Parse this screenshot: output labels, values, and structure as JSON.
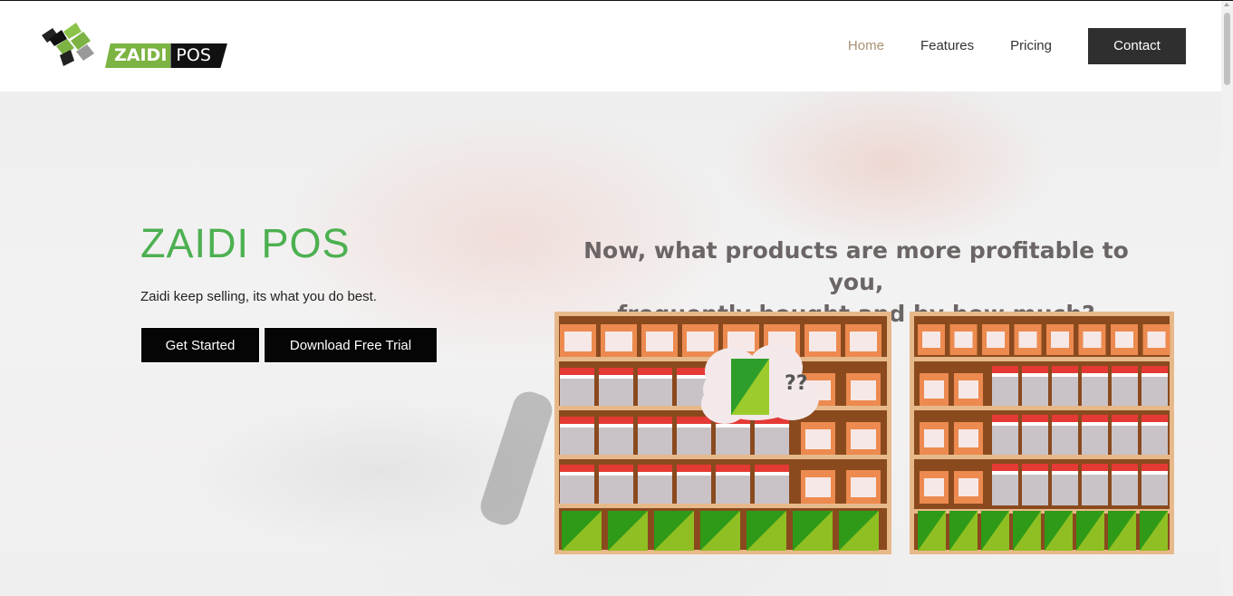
{
  "brand": {
    "name_part1": "ZAIDI",
    "name_part2": "POS"
  },
  "nav": {
    "items": [
      {
        "label": "Home",
        "active": true
      },
      {
        "label": "Features",
        "active": false
      },
      {
        "label": "Pricing",
        "active": false
      }
    ],
    "cta_label": "Contact"
  },
  "hero": {
    "title": "ZAIDI POS",
    "subtitle": "Zaidi keep selling, its what you do best.",
    "primary_button": "Get Started",
    "secondary_button": "Download Free Trial"
  },
  "promo": {
    "line1": "Now, what products are more profitable to you,",
    "line2": "frequently bought and by how much?",
    "bubble_text": "??"
  },
  "colors": {
    "accent_green": "#4cb050",
    "nav_active": "#a89274",
    "cta_dark": "#2f2f2f",
    "shelf_wood": "#e7b98a",
    "box_orange": "#ec8a4f",
    "box_red": "#e53935",
    "crate_green": "#5aac1e"
  }
}
